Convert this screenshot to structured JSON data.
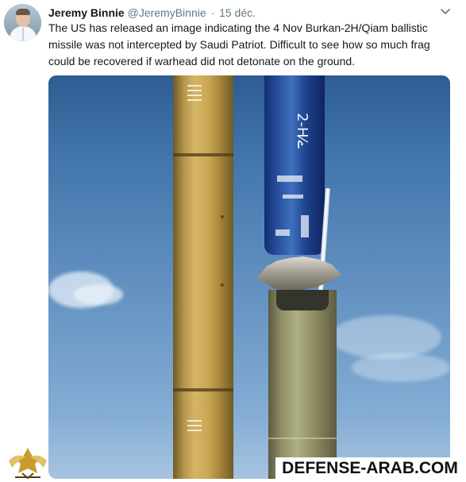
{
  "tweet": {
    "author_name": "Jeremy Binnie",
    "author_handle": "@JeremyBinnie",
    "separator": "·",
    "date": "15 déc.",
    "text": "The US has released an image indicating the 4 Nov Burkan-2H/Qiam ballistic missile was not intercepted by Saudi Patriot. Difficult to see how so much frag could be recovered if warhead did not detonate on the ground."
  },
  "media": {
    "missile_inscription": "2-H⁄ے",
    "watermark": "DEFENSE-ARAB.COM",
    "logo_text": "ADF ARAB DEFENSE FORUM"
  },
  "icons": {
    "caret": "chevron-down-icon",
    "avatar": "avatar-image"
  },
  "colors": {
    "text_primary": "#14171a",
    "text_secondary": "#657786",
    "sky_top": "#2e5c92",
    "sky_bottom": "#a7c4e0"
  }
}
